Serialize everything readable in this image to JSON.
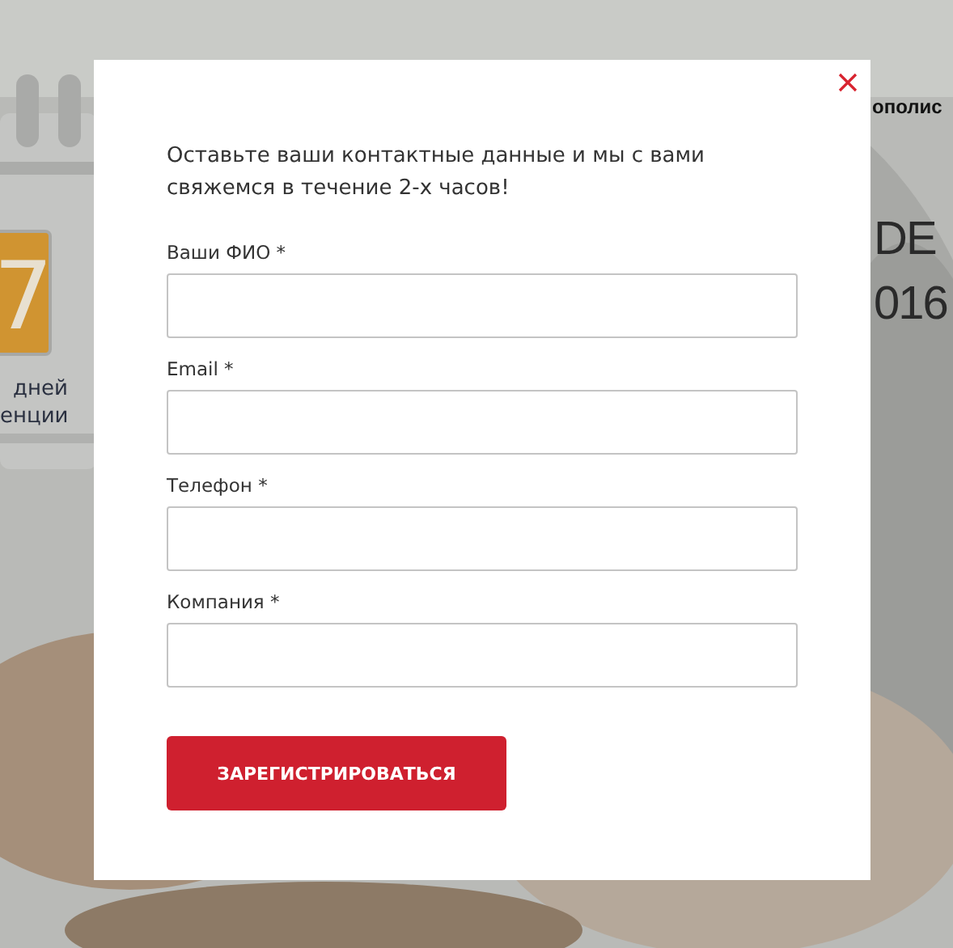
{
  "background": {
    "badge": "7",
    "caption": [
      "дней",
      "енции"
    ],
    "heading_fragment": "ополис",
    "title_lines": [
      "DE",
      "016"
    ]
  },
  "modal": {
    "intro": "Оставьте ваши контактные данные и мы с вами свяжемся в течение 2-х часов!",
    "fields": [
      {
        "label": "Ваши ФИО *"
      },
      {
        "label": "Email *"
      },
      {
        "label": "Телефон *"
      },
      {
        "label": "Компания *"
      }
    ],
    "submit": "ЗАРЕГИСТРИРОВАТЬСЯ"
  }
}
